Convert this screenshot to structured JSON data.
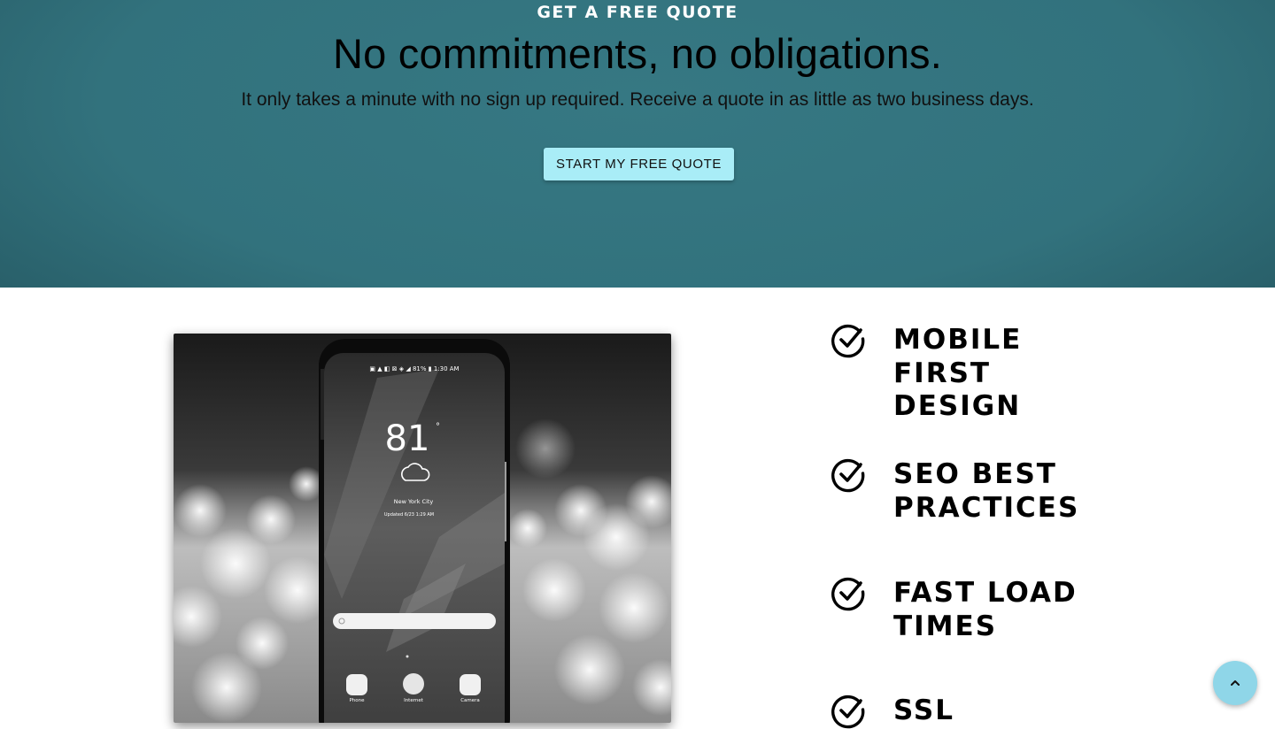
{
  "hero": {
    "eyebrow": "GET A FREE QUOTE",
    "headline": "No commitments, no obligations.",
    "subtext": "It only takes a minute with no sign up required. Receive a quote in as little as two business days.",
    "cta_label": "START MY FREE QUOTE"
  },
  "photo": {
    "phone_status": "▣ ▲ ◧   ⊠ ◈ ◢ 81% ▮ 1:30 AM",
    "phone_temp": "81",
    "phone_degree": "°",
    "phone_city": "New York City",
    "phone_updated": "Updated 6/23 1:29 AM",
    "apps": [
      "Phone",
      "Internet",
      "Camera"
    ]
  },
  "features": [
    {
      "label": "Mobile First Design",
      "icon": "check-circle-icon"
    },
    {
      "label": "SEO Best Practices",
      "icon": "check-circle-icon"
    },
    {
      "label": "Fast Load Times",
      "icon": "check-circle-icon"
    },
    {
      "label": "SSL",
      "icon": "check-circle-icon"
    }
  ],
  "back_to_top": {
    "icon": "chevron-up-icon"
  },
  "colors": {
    "hero_bg": "#32727d",
    "cta_bg": "#a9edf7",
    "to_top_bg": "#8fd6e8"
  }
}
